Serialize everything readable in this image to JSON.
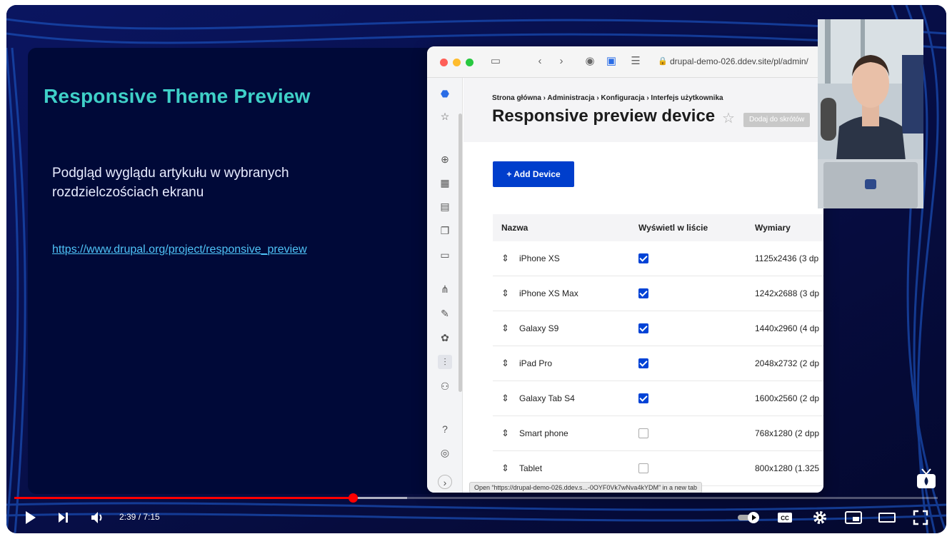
{
  "slide": {
    "title": "Responsive Theme Preview",
    "text": "Podgląd wyglądu artykułu w wybranych rozdzielczościach ekranu",
    "link": "https://www.drupal.org/project/responsive_preview"
  },
  "browser": {
    "url": "drupal-demo-026.ddev.site/pl/admin/",
    "breadcrumb": "Strona główna  ›  Administracja  ›  Konfiguracja  ›  Interfejs użytkownika",
    "page_title": "Responsive preview device",
    "shortcut_label": "Dodaj do skrótów",
    "add_button": "+ Add Device",
    "columns": [
      "Nazwa",
      "Wyświetl w liście",
      "Wymiary"
    ],
    "rows": [
      {
        "name": "iPhone XS",
        "checked": true,
        "dims": "1125x2436 (3 dp"
      },
      {
        "name": "iPhone XS Max",
        "checked": true,
        "dims": "1242x2688 (3 dp"
      },
      {
        "name": "Galaxy S9",
        "checked": true,
        "dims": "1440x2960 (4 dp"
      },
      {
        "name": "iPad Pro",
        "checked": true,
        "dims": "2048x2732 (2 dp"
      },
      {
        "name": "Galaxy Tab S4",
        "checked": true,
        "dims": "1600x2560 (2 dp"
      },
      {
        "name": "Smart phone",
        "checked": false,
        "dims": "768x1280 (2 dpp"
      },
      {
        "name": "Tablet",
        "checked": false,
        "dims": "800x1280 (1.325"
      }
    ],
    "status_text": "Open “https://drupal-demo-026.ddev.s...-0OYF0Vk7wNva4kYDM” in a new tab"
  },
  "player": {
    "time": "2:39 / 7:15",
    "progress_fraction": 0.367,
    "buffered_fraction": 0.425,
    "colors": {
      "progress": "#ff0000",
      "slide_bg": "#000938",
      "title": "#3fd0c8"
    }
  },
  "icons": [
    "play-icon",
    "next-icon",
    "volume-icon",
    "autoplay-toggle-icon",
    "captions-icon",
    "settings-icon",
    "miniplayer-icon",
    "theater-icon",
    "fullscreen-icon"
  ]
}
